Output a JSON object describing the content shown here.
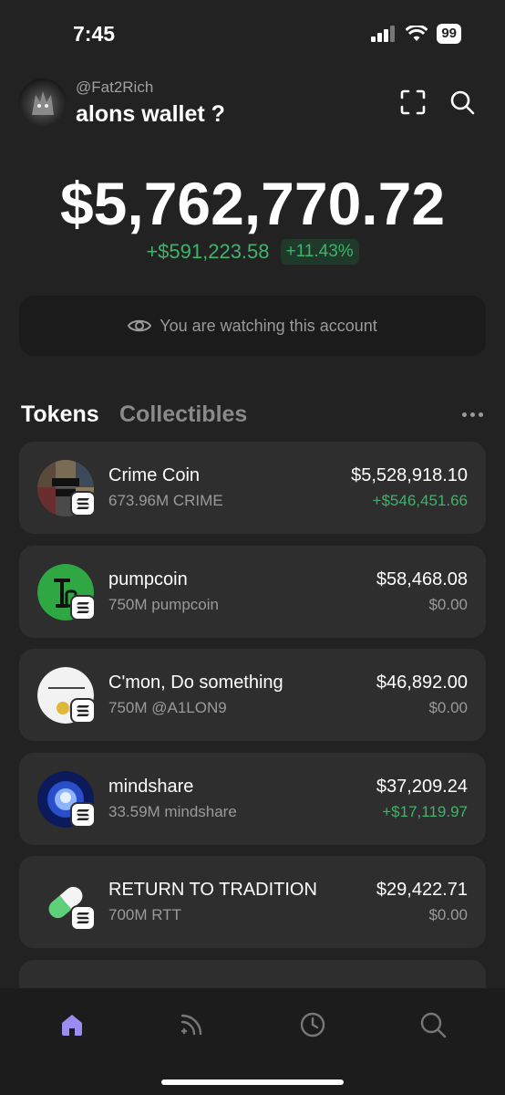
{
  "status_bar": {
    "time": "7:45",
    "battery": "99"
  },
  "header": {
    "handle": "@Fat2Rich",
    "wallet_name": "alons wallet ?"
  },
  "balance": {
    "total": "$5,762,770.72",
    "change_abs": "+$591,223.58",
    "change_pct": "+11.43%"
  },
  "watch_banner": {
    "text": "You are watching this account"
  },
  "tabs": {
    "tokens": "Tokens",
    "collectibles": "Collectibles"
  },
  "tokens": [
    {
      "name": "Crime Coin",
      "amount": "673.96M CRIME",
      "value": "$5,528,918.10",
      "change": "+$546,451.66",
      "trend": "up",
      "icon": "crime-coin-icon"
    },
    {
      "name": "pumpcoin",
      "amount": "750M pumpcoin",
      "value": "$58,468.08",
      "change": "$0.00",
      "trend": "flat",
      "icon": "pumpcoin-icon"
    },
    {
      "name": "C'mon, Do something",
      "amount": "750M @A1LON9",
      "value": "$46,892.00",
      "change": "$0.00",
      "trend": "flat",
      "icon": "cmon-icon"
    },
    {
      "name": "mindshare",
      "amount": "33.59M mindshare",
      "value": "$37,209.24",
      "change": "+$17,119.97",
      "trend": "up",
      "icon": "mindshare-icon"
    },
    {
      "name": "RETURN TO TRADITION",
      "amount": "700M RTT",
      "value": "$29,422.71",
      "change": "$0.00",
      "trend": "flat",
      "icon": "pill-icon"
    }
  ],
  "colors": {
    "background": "#222222",
    "card": "#2e2e2e",
    "positive": "#3fb36b",
    "accent_nav": "#9b8cf2"
  },
  "nav": [
    "home-icon",
    "activity-icon",
    "history-icon",
    "search-icon"
  ]
}
